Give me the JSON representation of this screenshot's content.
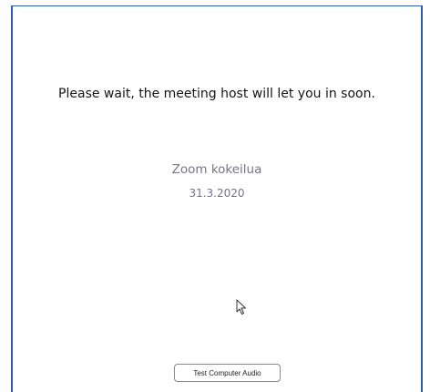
{
  "waiting_room": {
    "message": "Please wait, the meeting host will let you in soon.",
    "meeting_title": "Zoom kokeilua",
    "meeting_date": "31.3.2020",
    "test_audio_button_label": "Test Computer Audio"
  },
  "colors": {
    "window_border": "#2a5ea8",
    "message_text": "#141414",
    "secondary_text": "#747487"
  },
  "icons": {
    "cursor": "mouse-pointer-icon"
  }
}
